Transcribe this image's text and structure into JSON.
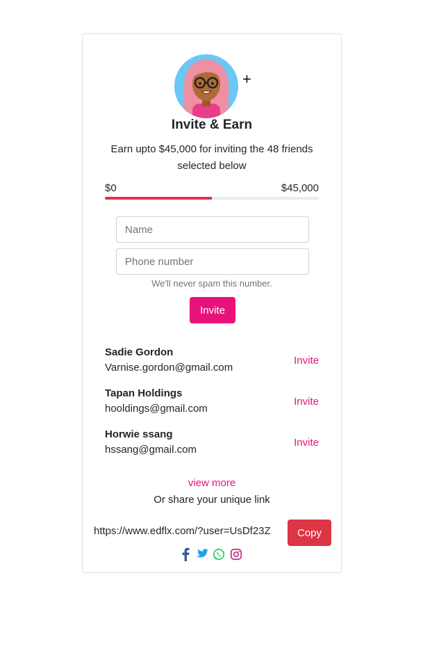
{
  "header": {
    "title": "Invite & Earn",
    "plus_glyph": "+",
    "subtitle": "Earn upto $45,000 for inviting the 48 friends selected below"
  },
  "progress": {
    "min_label": "$0",
    "max_label": "$45,000",
    "fraction": 0.5,
    "fill_color": "#dc3545"
  },
  "form": {
    "name_placeholder": "Name",
    "phone_placeholder": "Phone number",
    "help_text": "We'll never spam this number.",
    "invite_label": "Invite"
  },
  "friends": [
    {
      "name": "Sadie Gordon",
      "email": "Varnise.gordon@gmail.com",
      "action": "Invite"
    },
    {
      "name": "Tapan Holdings",
      "email": "hooldings@gmail.com",
      "action": "Invite"
    },
    {
      "name": "Horwie ssang",
      "email": "hssang@gmail.com",
      "action": "Invite"
    }
  ],
  "footer": {
    "view_more": "view more",
    "share_text": "Or share your unique link",
    "link": "https://www.edflx.com/?user=UsDf23Z",
    "copy_label": "Copy",
    "socials": [
      "facebook-icon",
      "twitter-icon",
      "whatsapp-icon",
      "instagram-icon"
    ]
  },
  "colors": {
    "accent_pink": "#e8137a",
    "copy_red": "#dc3545"
  }
}
